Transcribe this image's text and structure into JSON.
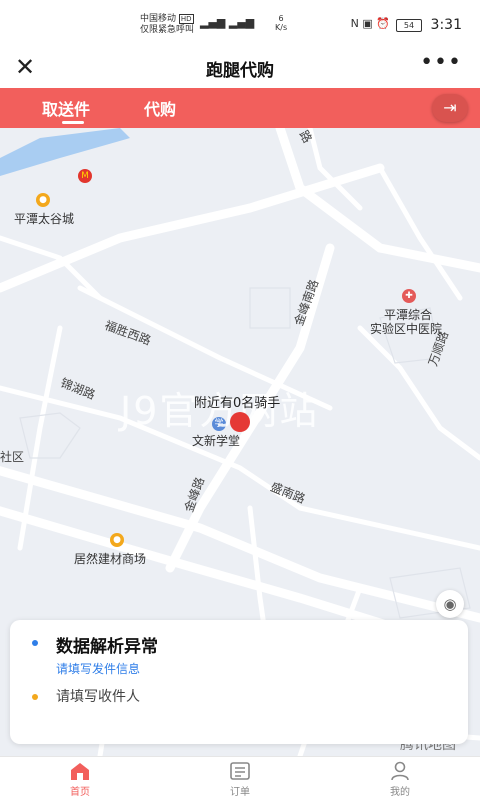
{
  "statusbar": {
    "carrier": "中国移动",
    "carrier_badge": "HD",
    "emergency": "仅限紧急呼叫",
    "speed_value": "6",
    "speed_unit": "K/s",
    "battery": "54",
    "time": "3:31"
  },
  "header": {
    "close_icon": "close-icon",
    "title": "跑腿代购",
    "more_icon": "more-icon"
  },
  "tabs": {
    "items": [
      {
        "label": "取送件",
        "active": true
      },
      {
        "label": "代购",
        "active": false
      }
    ],
    "exit_icon": "exit-icon"
  },
  "map": {
    "watermark": "J9官方网站",
    "marker_label": "附近有0名骑手",
    "locate_icon": "locate-icon",
    "provider": "腾讯地图",
    "roads": [
      {
        "label": "福胜西路"
      },
      {
        "label": "锦湖路"
      },
      {
        "label": "金峰南路"
      },
      {
        "label": "金峰路"
      },
      {
        "label": "盛南路"
      },
      {
        "label": "万顺路"
      },
      {
        "label": "社区"
      }
    ],
    "pois": [
      {
        "label": "平潭太谷城",
        "icon": "mcdonalds-icon"
      },
      {
        "label": "平潭综合",
        "label2": "实验区中医院",
        "icon": "hospital-icon"
      },
      {
        "label": "文新学堂",
        "icon": "school-icon"
      },
      {
        "label": "居然建材商场",
        "icon": "shop-icon"
      }
    ],
    "colors": {
      "road": "#ffffff",
      "land": "#eceff4",
      "water": "#a9cdf2",
      "marker": "#e53935"
    }
  },
  "card": {
    "error_title": "数据解析异常",
    "sender_hint": "请填写发件信息",
    "receiver_hint": "请填写收件人"
  },
  "bottom_nav": {
    "items": [
      {
        "label": "首页",
        "icon": "home-icon",
        "active": true
      },
      {
        "label": "订单",
        "icon": "order-icon",
        "active": false
      },
      {
        "label": "我的",
        "icon": "user-icon",
        "active": false
      }
    ],
    "active_color": "#f25f5c",
    "inactive_color": "#888888"
  }
}
